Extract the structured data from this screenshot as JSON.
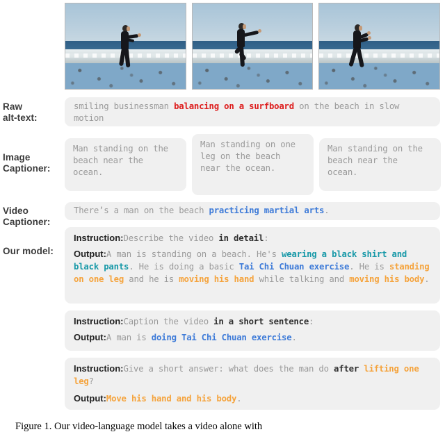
{
  "figure": {
    "caption": "Figure 1. Our video-language model takes a video alone with"
  },
  "frames": [
    {
      "alt": "man in black doing tai chi on beach, both feet on sand, arms forward"
    },
    {
      "alt": "man in black standing on one leg on beach, arm extended"
    },
    {
      "alt": "man in black in wide stance on beach, hands raised in front"
    }
  ],
  "rows": [
    {
      "label_line1": "Raw",
      "label_line2": "alt-text:"
    },
    {
      "label_line1": "Image",
      "label_line2": "Captioner:"
    },
    {
      "label_line1": "Video",
      "label_line2": "Captioner:"
    },
    {
      "label_line1": "Our model:",
      "label_line2": ""
    }
  ],
  "raw_alt_text": {
    "segments": [
      {
        "text": "smiling businessman ",
        "style": "plain"
      },
      {
        "text": "balancing on a surfboard",
        "style": "red"
      },
      {
        "text": " on the beach in slow motion",
        "style": "plain"
      }
    ]
  },
  "image_captioner": {
    "captions": [
      "Man standing on the beach near the ocean.",
      "Man standing on one leg on the beach near the ocean.",
      "Man standing on the beach near the ocean."
    ]
  },
  "video_captioner": {
    "segments": [
      {
        "text": "There’s a man on the beach ",
        "style": "plain"
      },
      {
        "text": "practicing martial arts",
        "style": "blue"
      },
      {
        "text": ".",
        "style": "plain"
      }
    ]
  },
  "our_model": {
    "blocks": [
      {
        "instruction_tag": "Instruction:",
        "instruction_segments": [
          {
            "text": "Describe the video ",
            "style": "plain"
          },
          {
            "text": "in detail",
            "style": "dark"
          },
          {
            "text": ":",
            "style": "plain"
          }
        ],
        "output_tag": "Output:",
        "output_segments": [
          {
            "text": "A man is standing on a beach. He's ",
            "style": "plain"
          },
          {
            "text": "wearing a black shirt and black pants",
            "style": "teal"
          },
          {
            "text": ". He is doing a basic ",
            "style": "plain"
          },
          {
            "text": "Tai Chi Chuan exercise",
            "style": "blue"
          },
          {
            "text": ". He is ",
            "style": "plain"
          },
          {
            "text": "standing on one leg",
            "style": "orange"
          },
          {
            "text": " and he is ",
            "style": "plain"
          },
          {
            "text": "moving his hand",
            "style": "orange"
          },
          {
            "text": " while talking and ",
            "style": "plain"
          },
          {
            "text": "moving his body",
            "style": "orange"
          },
          {
            "text": ".",
            "style": "plain"
          }
        ]
      },
      {
        "instruction_tag": "Instruction:",
        "instruction_segments": [
          {
            "text": "Caption the video ",
            "style": "plain"
          },
          {
            "text": "in a short sentence",
            "style": "dark"
          },
          {
            "text": ":",
            "style": "plain"
          }
        ],
        "output_tag": "Output:",
        "output_segments": [
          {
            "text": "A man is ",
            "style": "plain"
          },
          {
            "text": "doing Tai Chi Chuan exercise",
            "style": "blue"
          },
          {
            "text": ".",
            "style": "plain"
          }
        ]
      },
      {
        "instruction_tag": "Instruction:",
        "instruction_segments": [
          {
            "text": "Give a short answer: what does the man do ",
            "style": "plain"
          },
          {
            "text": "after ",
            "style": "dark"
          },
          {
            "text": "lifting one leg",
            "style": "orange"
          },
          {
            "text": "?",
            "style": "plain"
          }
        ],
        "output_tag": "Output:",
        "output_segments": [
          {
            "text": "Move his hand and his body",
            "style": "orange"
          },
          {
            "text": ".",
            "style": "plain"
          }
        ]
      }
    ]
  },
  "colors": {
    "red": "#dd1c1c",
    "blue": "#3e7bd8",
    "teal": "#1899a8",
    "orange": "#f5a33c",
    "panel_bg": "#f0f0f0",
    "mono_text": "#9a9a9a",
    "label_text": "#3b3b3b"
  }
}
